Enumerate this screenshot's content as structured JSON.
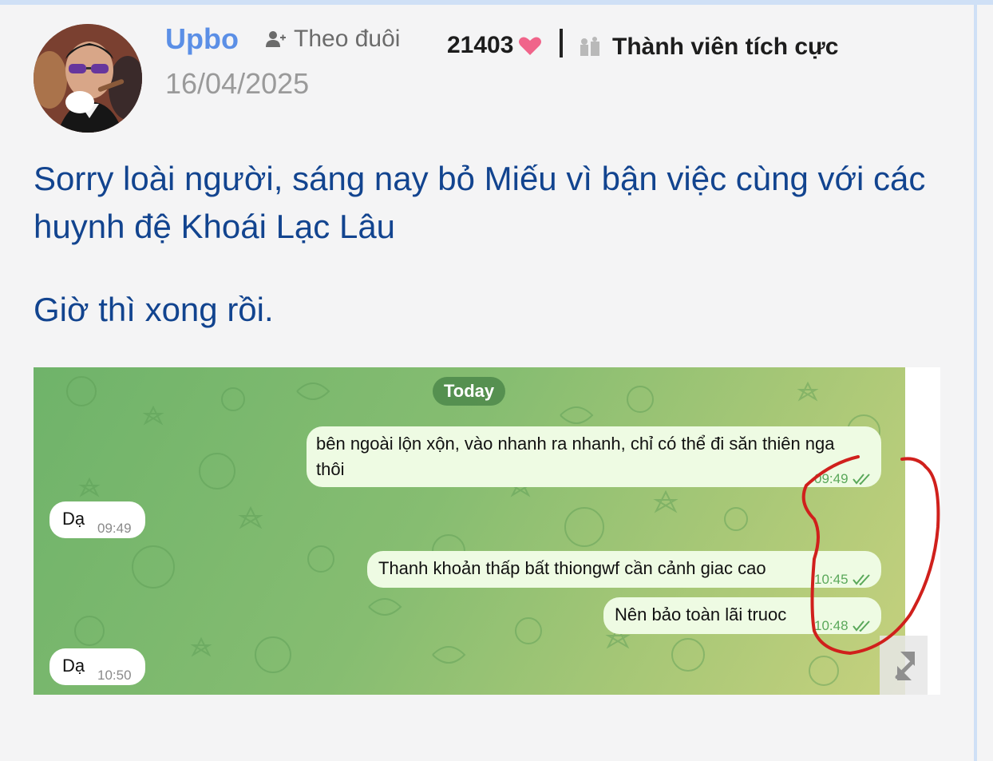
{
  "post": {
    "author": "Upbo",
    "follow_label": "Theo đuôi",
    "date": "16/04/2025",
    "likes": "21403",
    "rank": "Thành viên tích cực",
    "paragraph_1": "Sorry loài người, sáng nay bỏ Miếu vì bận việc cùng với các huynh đệ Khoái Lạc Lâu",
    "paragraph_2": "Giờ thì xong rồi."
  },
  "chat": {
    "day_label": "Today",
    "messages": [
      {
        "dir": "out",
        "text": "bên ngoài lộn xộn, vào nhanh ra nhanh, chỉ có thể đi săn thiên nga thôi",
        "time": "09:49"
      },
      {
        "dir": "in",
        "text": "Dạ",
        "time": "09:49"
      },
      {
        "dir": "out",
        "text": "Thanh khoản thấp bất thiongwf cần cảnh giac cao",
        "time": "10:45"
      },
      {
        "dir": "out",
        "text": "Nên bảo toàn lãi truoc",
        "time": "10:48"
      },
      {
        "dir": "in",
        "text": "Dạ",
        "time": "10:50"
      }
    ]
  },
  "colors": {
    "author": "#5b8fe6",
    "body_text": "#12448f",
    "heart": "#f0648a",
    "annotation": "#d0201c"
  },
  "icons": {
    "follow": "person-plus-icon",
    "heart": "heart-icon",
    "rank": "members-icon",
    "read_receipt": "double-check-icon",
    "expand": "expand-icon"
  }
}
